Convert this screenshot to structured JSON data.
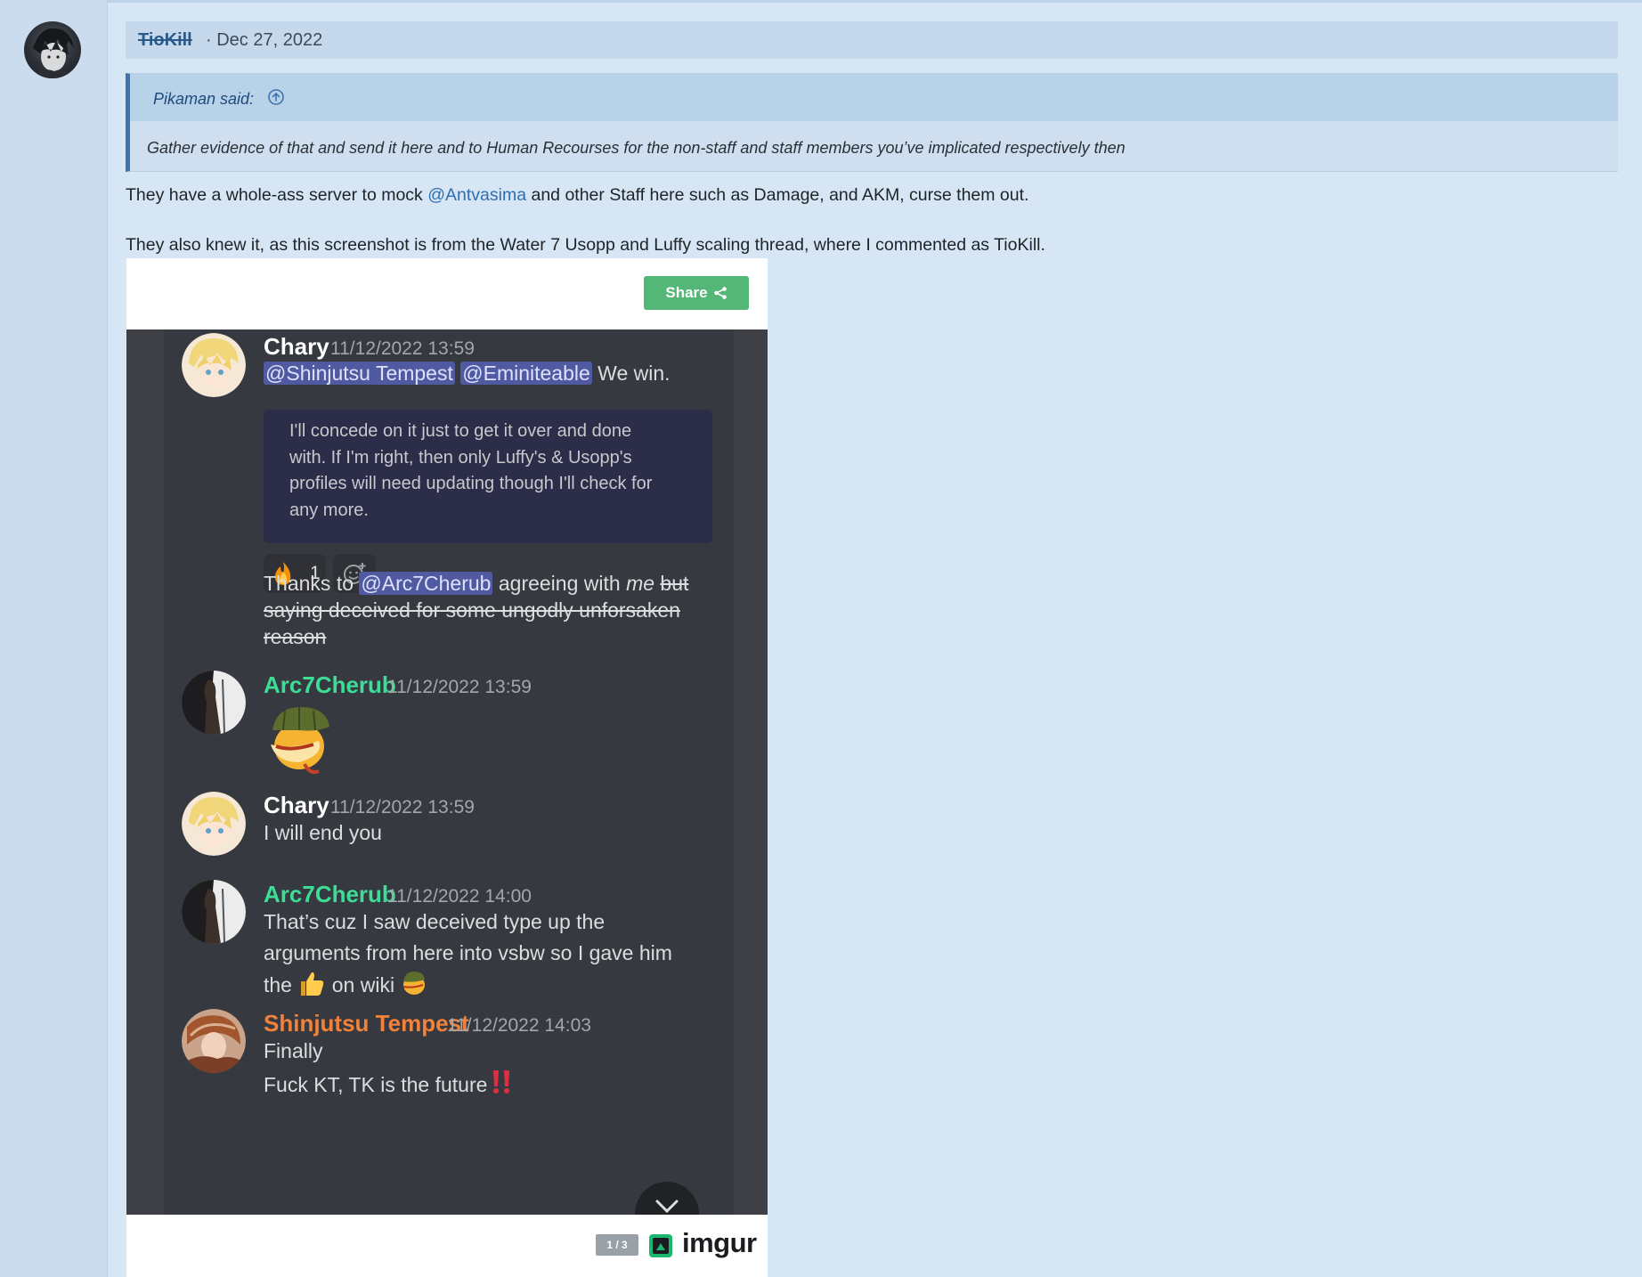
{
  "post": {
    "username": "TioKill",
    "date": "· Dec 27, 2022",
    "quote": {
      "author": "Pikaman said:",
      "body": "Gather evidence of that and send it here and to Human Recourses for the non-staff and staff members you’ve implicated respectively then"
    },
    "paragraph1": {
      "before": "They have a whole-ass server to mock ",
      "mention": "@Antvasima",
      "after": " and other Staff here such as Damage, and AKM, curse them out."
    },
    "paragraph2": "They also knew it, as this screenshot is from the Water 7 Usopp and Luffy scaling thread, where I commented as TioKill."
  },
  "embed": {
    "share_label": "Share",
    "counter": "1 / 3",
    "brand": "imgur"
  },
  "discord": {
    "msg1": {
      "name": "Chary",
      "time": "11/12/2022 13:59",
      "mention1": "@Shinjutsu Tempest",
      "mention2": "@Eminiteable",
      "text": " We win.",
      "reply_lines": [
        "I'll concede on it just to get it over and done",
        "with. If I'm right, then only Luffy's & Usopp's",
        "profiles will need updating though I'll check for",
        "any more."
      ],
      "reaction_count": "1",
      "line1_pre": "Thanks to ",
      "line1_mention": "@Arc7Cherub",
      "line1_mid": " agreeing with ",
      "line1_italic": "me",
      "line1_strike": "but",
      "line2": "saying deceived for some ungodly unforsaken",
      "line3": "reason"
    },
    "msg2": {
      "name": "Arc7Cherub",
      "time": "11/12/2022 13:59"
    },
    "msg3": {
      "name": "Chary",
      "time": "11/12/2022 13:59",
      "text": "I will end you"
    },
    "msg4": {
      "name": "Arc7Cherub",
      "time": "11/12/2022 14:00",
      "lines": [
        "That’s cuz I saw deceived type up the",
        "arguments from here into vsbw so I gave him"
      ],
      "line3_pre": "the ",
      "line3_mid": " on wiki "
    },
    "msg5": {
      "name": "Shinjutsu Tempest",
      "time": "11/12/2022 14:03",
      "line1": "Finally",
      "line2": "Fuck KT, TK is the future"
    },
    "colors": {
      "chary": "#ffffff",
      "arc7cherub": "#3ddc97",
      "shinjutsu": "#f0823c"
    }
  }
}
